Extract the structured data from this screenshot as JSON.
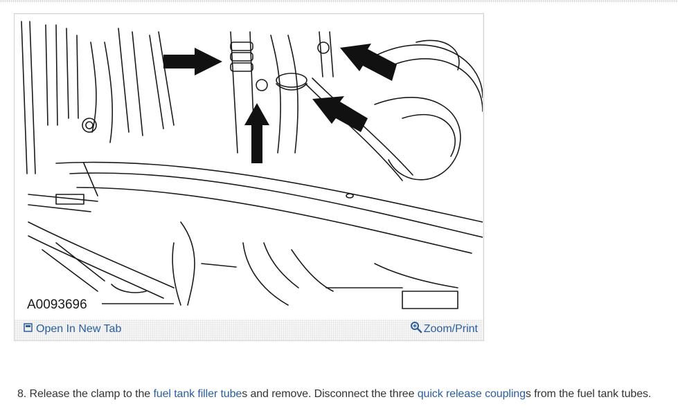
{
  "figure": {
    "part_number": "A0093696",
    "open_in_new_tab_label": "Open In New Tab",
    "zoom_print_label": "Zoom/Print",
    "open_icon": "new-tab-icon",
    "zoom_icon": "magnifier-icon"
  },
  "step": {
    "number": "8.",
    "text_part1": " Release the clamp to the ",
    "link1": "fuel tank filler tube",
    "text_part2": "s and remove. Disconnect the three ",
    "link2": "quick release coupling",
    "text_part3": "s from the fuel tank tubes."
  },
  "colors": {
    "link": "#2a5d9f",
    "body_text": "#333333",
    "frame_border": "#d2d2d2"
  }
}
